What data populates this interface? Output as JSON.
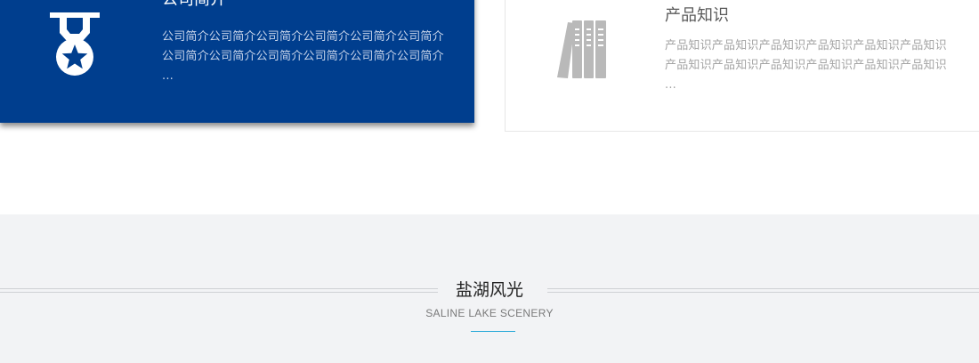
{
  "cards": [
    {
      "title": "公司简介",
      "description": "公司简介公司简介公司简介公司简介公司简介公司简介公司简介公司简介公司简介公司简介公司简介公司简介 ...",
      "icon": "medal-icon",
      "colors": {
        "background": "#003e8e",
        "text": "#ffffff"
      }
    },
    {
      "title": "产品知识",
      "description": "产品知识产品知识产品知识产品知识产品知识产品知识产品知识产品知识产品知识产品知识产品知识产品知识 ...",
      "icon": "binders-icon",
      "colors": {
        "background": "#ffffff",
        "text": "#a4a4a4"
      }
    }
  ],
  "scenery": {
    "title": "盐湖风光",
    "subtitle": "SALINE LAKE SCENERY",
    "colors": {
      "background": "#f2f3f5",
      "accent": "#29a9d8"
    }
  }
}
